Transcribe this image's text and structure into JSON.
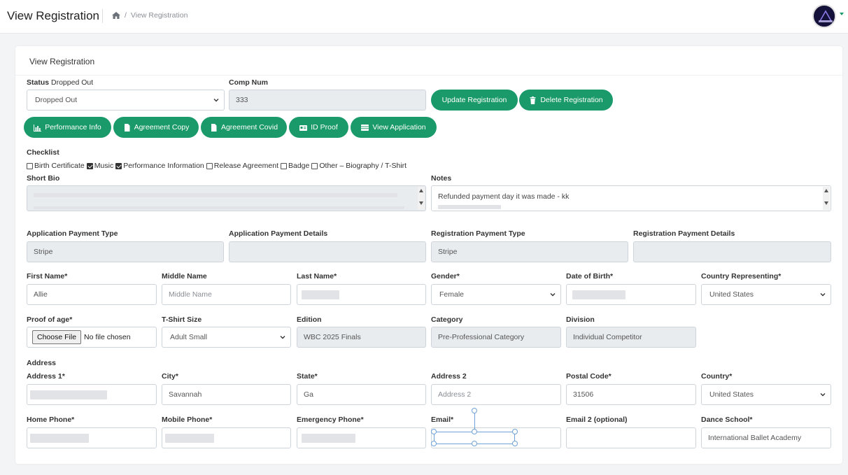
{
  "header": {
    "title": "View Registration",
    "breadcrumb": "View Registration",
    "accent_color": "#1a9a6a"
  },
  "card": {
    "title": "View Registration"
  },
  "status": {
    "label": "Status",
    "current": "Dropped Out",
    "selected": "Dropped Out"
  },
  "comp_num": {
    "label": "Comp Num",
    "value": "333"
  },
  "actions": {
    "update": "Update Registration",
    "delete": "Delete Registration"
  },
  "docs": {
    "performance_info": "Performance Info",
    "agreement_copy": "Agreement Copy",
    "agreement_covid": "Agreement Covid",
    "id_proof": "ID Proof",
    "view_application": "View Application"
  },
  "checklist": {
    "label": "Checklist",
    "items": [
      {
        "label": "Birth Certificate",
        "checked": false
      },
      {
        "label": "Music",
        "checked": true
      },
      {
        "label": "Performance Information",
        "checked": true
      },
      {
        "label": "Release Agreement",
        "checked": false
      },
      {
        "label": "Badge",
        "checked": false
      },
      {
        "label": "Other – Biography / T-Shirt",
        "checked": false
      }
    ]
  },
  "short_bio": {
    "label": "Short Bio",
    "value": ""
  },
  "notes": {
    "label": "Notes",
    "value": "Refunded payment day it was made - kk"
  },
  "payment": {
    "app_type_label": "Application Payment Type",
    "app_type_value": "Stripe",
    "app_details_label": "Application Payment Details",
    "app_details_value": "",
    "reg_type_label": "Registration Payment Type",
    "reg_type_value": "Stripe",
    "reg_details_label": "Registration Payment Details",
    "reg_details_value": ""
  },
  "person": {
    "first_name_label": "First Name*",
    "first_name_value": "Allie",
    "middle_name_label": "Middle Name",
    "middle_name_placeholder": "Middle Name",
    "last_name_label": "Last Name*",
    "gender_label": "Gender*",
    "gender_value": "Female",
    "dob_label": "Date of Birth*",
    "country_rep_label": "Country Representing*",
    "country_rep_value": "United States"
  },
  "details": {
    "proof_label": "Proof of age*",
    "choose_file": "Choose File",
    "no_file": "No file chosen",
    "tshirt_label": "T-Shirt Size",
    "tshirt_value": "Adult Small",
    "edition_label": "Edition",
    "edition_value": "WBC 2025 Finals",
    "category_label": "Category",
    "category_value": "Pre-Professional Category",
    "division_label": "Division",
    "division_value": "Individual Competitor"
  },
  "address": {
    "section_label": "Address",
    "address1_label": "Address 1*",
    "city_label": "City*",
    "city_value": "Savannah",
    "state_label": "State*",
    "state_value": "Ga",
    "address2_label": "Address 2",
    "address2_placeholder": "Address 2",
    "postal_label": "Postal Code*",
    "postal_value": "31506",
    "country_label": "Country*",
    "country_value": "United States"
  },
  "contact": {
    "home_phone_label": "Home Phone*",
    "mobile_phone_label": "Mobile Phone*",
    "emergency_phone_label": "Emergency Phone*",
    "email_label": "Email*",
    "email2_label": "Email 2 (optional)",
    "dance_school_label": "Dance School*",
    "dance_school_value": "International Ballet Academy"
  }
}
